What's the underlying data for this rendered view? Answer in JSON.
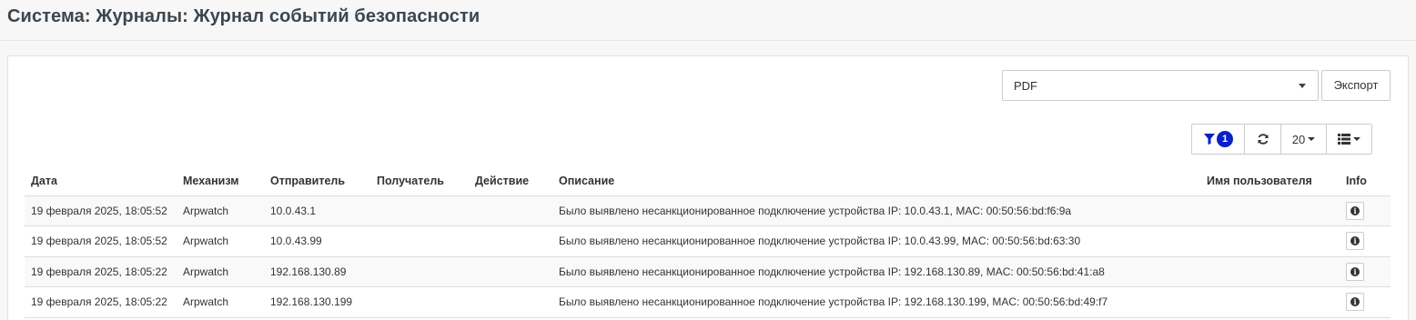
{
  "page": {
    "title": "Система: Журналы: Журнал событий безопасности"
  },
  "export": {
    "format_value": "PDF",
    "button_label": "Экспорт"
  },
  "toolbar": {
    "filter_count": "1",
    "page_size": "20"
  },
  "table": {
    "columns": [
      "Дата",
      "Механизм",
      "Отправитель",
      "Получатель",
      "Действие",
      "Описание",
      "Имя пользователя",
      "Info"
    ],
    "rows": [
      [
        "19 февраля 2025, 18:05:52",
        "Arpwatch",
        "10.0.43.1",
        "",
        "",
        "Было выявлено несанкционированное подключение устройства IP: 10.0.43.1, MAC: 00:50:56:bd:f6:9a",
        ""
      ],
      [
        "19 февраля 2025, 18:05:52",
        "Arpwatch",
        "10.0.43.99",
        "",
        "",
        "Было выявлено несанкционированное подключение устройства IP: 10.0.43.99, MAC: 00:50:56:bd:63:30",
        ""
      ],
      [
        "19 февраля 2025, 18:05:22",
        "Arpwatch",
        "192.168.130.89",
        "",
        "",
        "Было выявлено несанкционированное подключение устройства IP: 192.168.130.89, MAC: 00:50:56:bd:41:a8",
        ""
      ],
      [
        "19 февраля 2025, 18:05:22",
        "Arpwatch",
        "192.168.130.199",
        "",
        "",
        "Было выявлено несанкционированное подключение устройства IP: 192.168.130.199, MAC: 00:50:56:bd:49:f7",
        ""
      ]
    ]
  },
  "icons": {
    "filter": "filter-icon",
    "refresh": "refresh-icon",
    "columns": "columns-list-icon",
    "info": "info-circle-icon"
  },
  "colors": {
    "badge": "#0a20c8",
    "filter_icon": "#0a20c8"
  }
}
